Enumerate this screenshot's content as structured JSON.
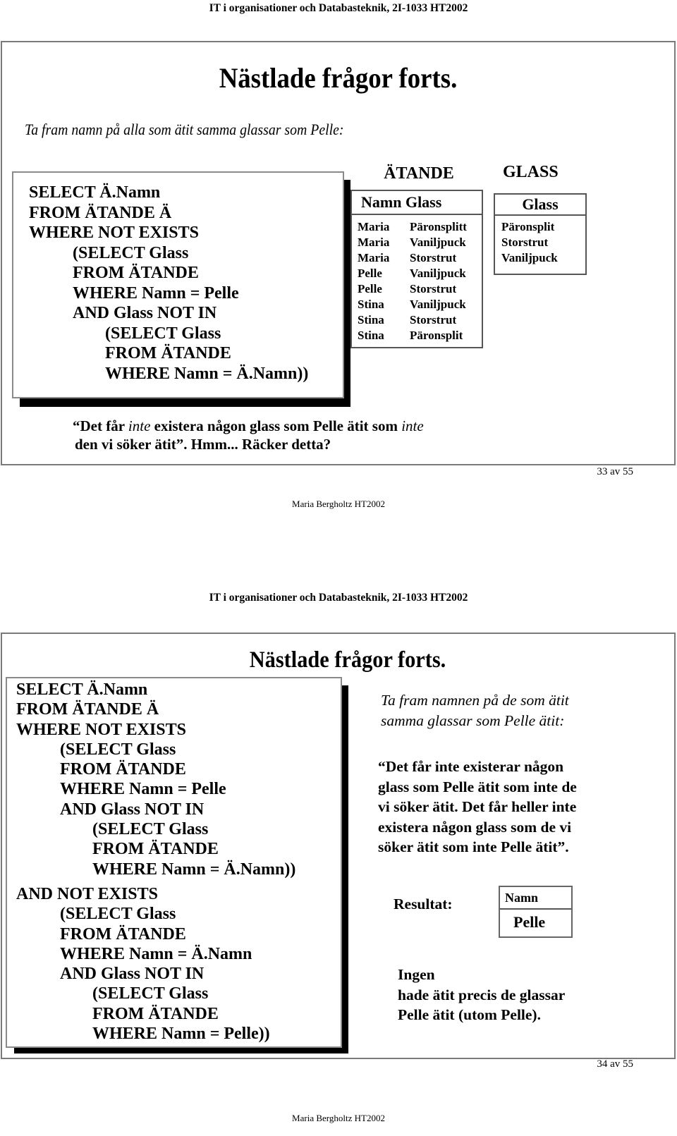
{
  "course_header": "IT i organisationer och Databasteknik, 2I-1033 HT2002",
  "author_footer": "Maria Bergholtz HT2002",
  "slide1": {
    "title": "Nästlade frågor forts.",
    "subtitle": "Ta fram namn på alla som ätit samma glassar som Pelle:",
    "code_lines": [
      {
        "indent": 0,
        "text": "SELECT Ä.Namn"
      },
      {
        "indent": 0,
        "text": "FROM ÄTANDE Ä"
      },
      {
        "indent": 0,
        "text": "WHERE NOT EXISTS"
      },
      {
        "indent": 1,
        "text": "(SELECT Glass"
      },
      {
        "indent": 1,
        "text": "FROM ÄTANDE"
      },
      {
        "indent": 1,
        "text": "WHERE Namn = Pelle"
      },
      {
        "indent": 1,
        "text": "AND Glass NOT IN"
      },
      {
        "indent": 2,
        "text": "(SELECT Glass"
      },
      {
        "indent": 2,
        "text": "FROM ÄTANDE"
      },
      {
        "indent": 2,
        "text": "WHERE Namn = Ä.Namn))"
      }
    ],
    "atande_table": {
      "title": "ÄTANDE",
      "columns": [
        "Namn",
        "Glass"
      ],
      "rows": [
        [
          "Maria",
          "Päronsplitt"
        ],
        [
          "Maria",
          "Vaniljpuck"
        ],
        [
          "Maria",
          "Storstrut"
        ],
        [
          "Pelle",
          "Vaniljpuck"
        ],
        [
          "Pelle",
          "Storstrut"
        ],
        [
          "Stina",
          "Vaniljpuck"
        ],
        [
          "Stina",
          "Storstrut"
        ],
        [
          "Stina",
          "Päronsplit"
        ]
      ]
    },
    "glass_table": {
      "title": "GLASS",
      "columns": [
        "Glass"
      ],
      "rows": [
        "Päronsplit",
        "Storstrut",
        "Vaniljpuck"
      ]
    },
    "comment": {
      "part1": "“Det får ",
      "em1": "inte",
      "part2": " existera någon glass som Pelle ätit som ",
      "em2": "inte",
      "line2": "den vi söker ätit”. Hmm... Räcker detta?"
    },
    "page": "33 av 55"
  },
  "slide2": {
    "title": "Nästlade frågor forts.",
    "code_lines": [
      {
        "indent": 0,
        "text": "SELECT Ä.Namn"
      },
      {
        "indent": 0,
        "text": "FROM ÄTANDE Ä"
      },
      {
        "indent": 0,
        "text": "WHERE NOT EXISTS"
      },
      {
        "indent": 1,
        "text": "(SELECT Glass"
      },
      {
        "indent": 1,
        "text": "FROM ÄTANDE"
      },
      {
        "indent": 1,
        "text": "WHERE Namn = Pelle"
      },
      {
        "indent": 1,
        "text": "AND Glass NOT IN"
      },
      {
        "indent": 2,
        "text": "(SELECT Glass"
      },
      {
        "indent": 2,
        "text": "FROM ÄTANDE"
      },
      {
        "indent": 2,
        "text": "WHERE Namn = Ä.Namn))"
      },
      {
        "indent": 0,
        "text": "AND NOT EXISTS"
      },
      {
        "indent": 1,
        "text": "(SELECT Glass"
      },
      {
        "indent": 1,
        "text": "FROM ÄTANDE"
      },
      {
        "indent": 1,
        "text": "WHERE Namn = Ä.Namn"
      },
      {
        "indent": 1,
        "text": "AND Glass NOT IN"
      },
      {
        "indent": 2,
        "text": "(SELECT Glass"
      },
      {
        "indent": 2,
        "text": "FROM ÄTANDE"
      },
      {
        "indent": 2,
        "text": "WHERE Namn = Pelle))"
      }
    ],
    "task_lines": [
      "Ta fram namnen på de som ätit",
      "samma glassar som Pelle ätit:"
    ],
    "explanation_lines": [
      "“Det får inte existerar någon",
      "glass som Pelle ätit som inte de",
      "vi söker ätit. Det får heller inte",
      "existera någon glass som de vi",
      "söker ätit som inte Pelle ätit”."
    ],
    "result_label": "Resultat:",
    "result_table": {
      "column": "Namn",
      "value": "Pelle"
    },
    "conclusion_lines": [
      "Ingen",
      "hade ätit precis de glassar",
      "Pelle ätit (utom Pelle)."
    ],
    "page": "34 av 55"
  }
}
